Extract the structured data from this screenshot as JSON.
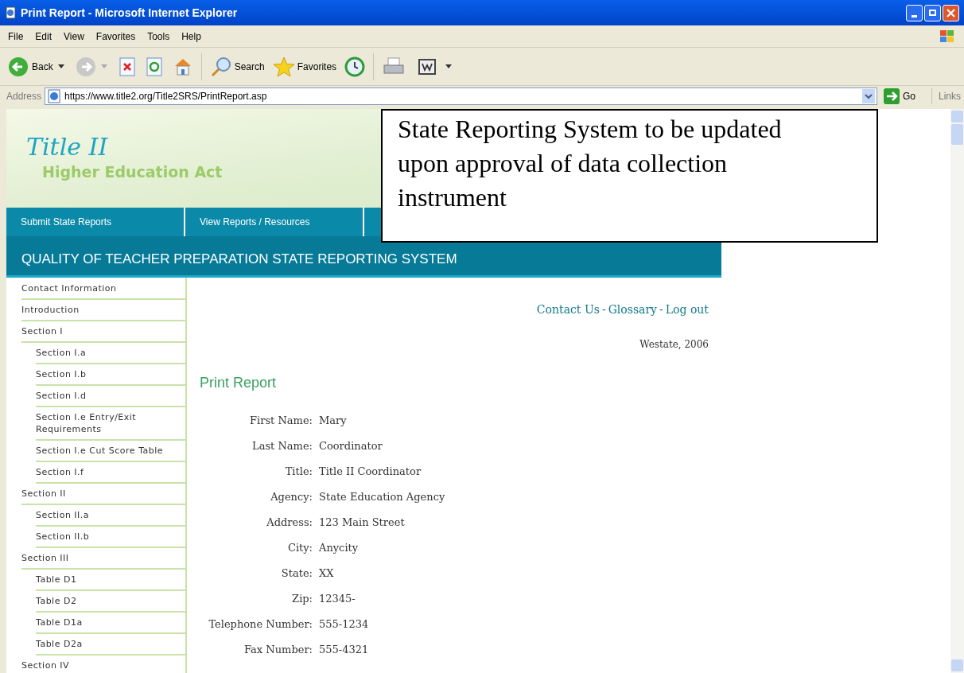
{
  "window": {
    "title": "Print Report - Microsoft Internet Explorer"
  },
  "menu": [
    "File",
    "Edit",
    "View",
    "Favorites",
    "Tools",
    "Help"
  ],
  "toolbar": {
    "back": "Back",
    "search": "Search",
    "favorites": "Favorites"
  },
  "address_bar": {
    "label": "Address",
    "url": "https://www.title2.org/Title2SRS/PrintReport.asp",
    "go": "Go",
    "links": "Links"
  },
  "banner": {
    "title": "Title II",
    "subtitle": "Higher Education Act"
  },
  "nav": [
    "Submit State Reports",
    "View Reports / Resources"
  ],
  "system_title": "QUALITY OF TEACHER PREPARATION STATE REPORTING SYSTEM",
  "callout": "State Reporting System to be updated upon approval of data collection instrument",
  "sidebar": {
    "items": [
      {
        "label": "Contact Information"
      },
      {
        "label": "Introduction"
      },
      {
        "label": "Section I",
        "children": [
          {
            "label": "Section I.a"
          },
          {
            "label": "Section I.b"
          },
          {
            "label": "Section I.d"
          },
          {
            "label": "Section I.e Entry/Exit Requirements"
          },
          {
            "label": "Section I.e Cut Score Table"
          },
          {
            "label": "Section I.f"
          }
        ]
      },
      {
        "label": "Section II",
        "children": [
          {
            "label": "Section II.a"
          },
          {
            "label": "Section II.b"
          }
        ]
      },
      {
        "label": "Section III",
        "children": [
          {
            "label": "Table D1"
          },
          {
            "label": "Table D2"
          },
          {
            "label": "Table D1a"
          },
          {
            "label": "Table D2a"
          }
        ]
      },
      {
        "label": "Section IV"
      }
    ]
  },
  "top_links": [
    "Contact Us",
    "Glossary",
    "Log out"
  ],
  "link_separator": "-",
  "state_year": "Westate, 2006",
  "page_title": "Print Report",
  "fields": [
    {
      "label": "First Name:",
      "value": "Mary"
    },
    {
      "label": "Last Name:",
      "value": "Coordinator"
    },
    {
      "label": "Title:",
      "value": "Title II Coordinator"
    },
    {
      "label": "Agency:",
      "value": "State Education Agency"
    },
    {
      "label": "Address:",
      "value": "123 Main Street"
    },
    {
      "label": "City:",
      "value": "Anycity"
    },
    {
      "label": "State:",
      "value": "XX"
    },
    {
      "label": "Zip:",
      "value": "12345-"
    },
    {
      "label": "Telephone Number:",
      "value": "555-1234"
    },
    {
      "label": "Fax Number:",
      "value": "555-4321"
    }
  ]
}
